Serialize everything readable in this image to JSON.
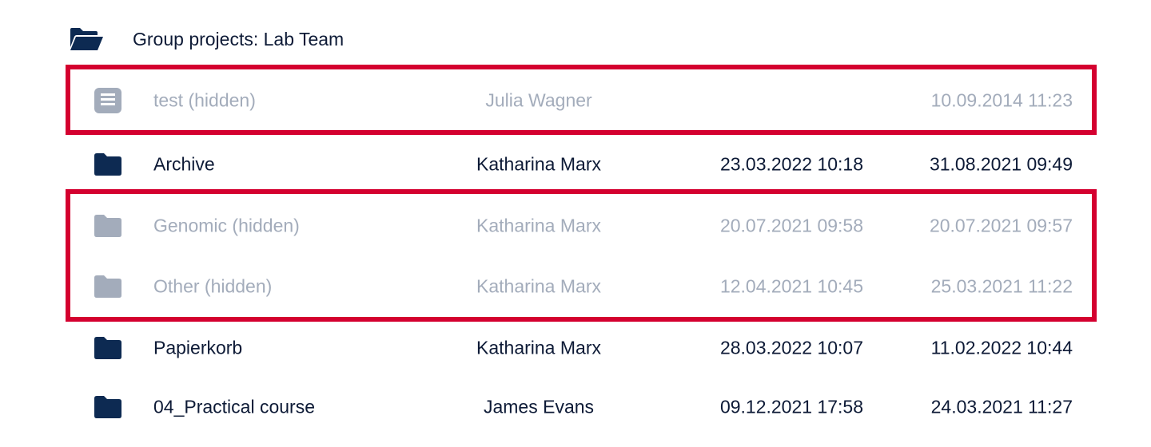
{
  "header": {
    "title": "Group projects: Lab Team",
    "icon": "folder-open-icon"
  },
  "colors": {
    "visible_text": "#0d1a36",
    "hidden_text": "#a3acbb",
    "highlight_border": "#d4002f",
    "folder_dark": "#0d2a52",
    "folder_muted": "#a3acbb"
  },
  "rows": [
    {
      "name": "test (hidden)",
      "owner": "Julia Wagner",
      "created": "",
      "modified": "10.09.2014 11:23",
      "hidden": true,
      "icon": "document-icon"
    },
    {
      "name": "Archive",
      "owner": "Katharina Marx",
      "created": "23.03.2022 10:18",
      "modified": "31.08.2021 09:49",
      "hidden": false,
      "icon": "folder-icon"
    },
    {
      "name": "Genomic (hidden)",
      "owner": "Katharina Marx",
      "created": "20.07.2021 09:58",
      "modified": "20.07.2021 09:57",
      "hidden": true,
      "icon": "folder-icon"
    },
    {
      "name": "Other (hidden)",
      "owner": "Katharina Marx",
      "created": "12.04.2021 10:45",
      "modified": "25.03.2021 11:22",
      "hidden": true,
      "icon": "folder-icon"
    },
    {
      "name": "Papierkorb",
      "owner": "Katharina Marx",
      "created": "28.03.2022 10:07",
      "modified": "11.02.2022 10:44",
      "hidden": false,
      "icon": "folder-icon"
    },
    {
      "name": "04_Practical course",
      "owner": "James Evans",
      "created": "09.12.2021 17:58",
      "modified": "24.03.2021 11:27",
      "hidden": false,
      "icon": "folder-icon"
    }
  ]
}
